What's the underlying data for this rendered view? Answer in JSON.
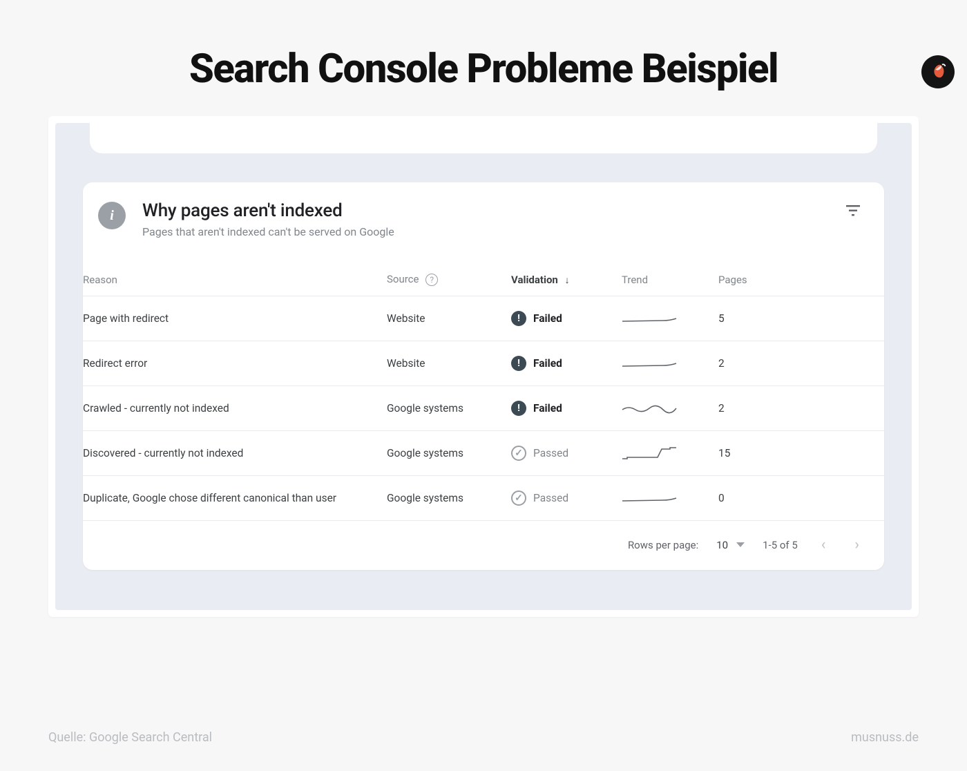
{
  "page": {
    "title": "Search Console Probleme Beispiel",
    "source_caption": "Quelle: Google Search Central",
    "site_caption": "musnuss.de"
  },
  "card": {
    "title": "Why pages aren't indexed",
    "subtitle": "Pages that aren't indexed can't be served on Google"
  },
  "columns": {
    "reason": "Reason",
    "source": "Source",
    "validation": "Validation",
    "trend": "Trend",
    "pages": "Pages"
  },
  "rows": [
    {
      "reason": "Page with redirect",
      "source": "Website",
      "validation": "Failed",
      "pages": "5",
      "trend": "flat-up"
    },
    {
      "reason": "Redirect error",
      "source": "Website",
      "validation": "Failed",
      "pages": "2",
      "trend": "flat-up"
    },
    {
      "reason": "Crawled - currently not indexed",
      "source": "Google systems",
      "validation": "Failed",
      "pages": "2",
      "trend": "wavy"
    },
    {
      "reason": "Discovered - currently not indexed",
      "source": "Google systems",
      "validation": "Passed",
      "pages": "15",
      "trend": "step-up"
    },
    {
      "reason": "Duplicate, Google chose different canonical than user",
      "source": "Google systems",
      "validation": "Passed",
      "pages": "0",
      "trend": "flat-up"
    }
  ],
  "pagination": {
    "rows_label": "Rows per page:",
    "rows_value": "10",
    "range": "1-5 of 5"
  }
}
